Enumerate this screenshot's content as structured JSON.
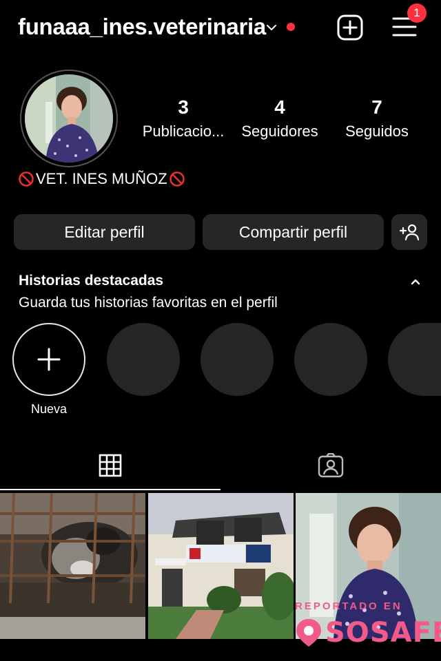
{
  "header": {
    "username": "funaaa_ines.veterinaria",
    "notification_count": "1",
    "accent_color": "#ff3040"
  },
  "profile": {
    "stats": [
      {
        "value": "3",
        "label": "Publicacio..."
      },
      {
        "value": "4",
        "label": "Seguidores"
      },
      {
        "value": "7",
        "label": "Seguidos"
      }
    ],
    "bio_name": "VET. INES MUÑOZ",
    "bio_icon": "no-entry-icon"
  },
  "actions": {
    "edit_label": "Editar perfil",
    "share_label": "Compartir perfil"
  },
  "highlights": {
    "title": "Historias destacadas",
    "subtitle": "Guarda tus historias favoritas en el perfil",
    "new_label": "Nueva"
  },
  "tabs": {
    "active": "grid",
    "items": [
      "grid-icon",
      "tagged-icon"
    ]
  },
  "posts": [
    {
      "subject": "cat-behind-bars-photo"
    },
    {
      "subject": "veterinary-building-photo"
    },
    {
      "subject": "woman-portrait-photo"
    }
  ],
  "watermark": {
    "reported_text": "REPORTADO EN",
    "brand": "SOSAFE",
    "color": "#f25a8a"
  }
}
